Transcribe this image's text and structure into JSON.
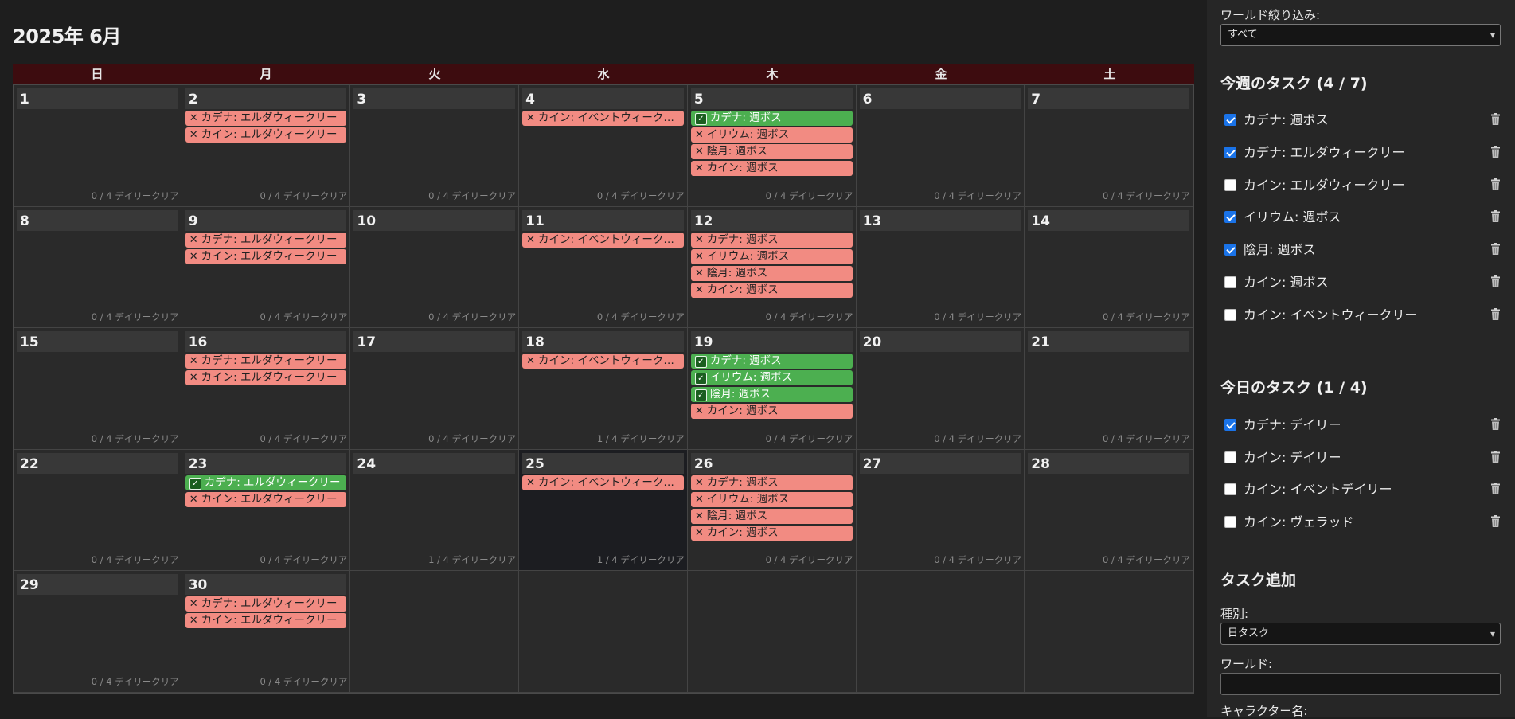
{
  "calendar": {
    "title": "2025年 6月",
    "weekdays": [
      "日",
      "月",
      "火",
      "水",
      "木",
      "金",
      "土"
    ],
    "today": 25,
    "days": [
      {
        "day": "1",
        "daily": "0 / 4 デイリークリア",
        "tasks": []
      },
      {
        "day": "2",
        "daily": "0 / 4 デイリークリア",
        "tasks": [
          {
            "label": "カデナ: エルダウィークリー",
            "done": false
          },
          {
            "label": "カイン: エルダウィークリー",
            "done": false
          }
        ]
      },
      {
        "day": "3",
        "daily": "0 / 4 デイリークリア",
        "tasks": []
      },
      {
        "day": "4",
        "daily": "0 / 4 デイリークリア",
        "tasks": [
          {
            "label": "カイン: イベントウィークリー",
            "done": false
          }
        ]
      },
      {
        "day": "5",
        "daily": "0 / 4 デイリークリア",
        "tasks": [
          {
            "label": "カデナ: 週ボス",
            "done": true
          },
          {
            "label": "イリウム: 週ボス",
            "done": false
          },
          {
            "label": "陰月: 週ボス",
            "done": false
          },
          {
            "label": "カイン: 週ボス",
            "done": false
          }
        ]
      },
      {
        "day": "6",
        "daily": "0 / 4 デイリークリア",
        "tasks": []
      },
      {
        "day": "7",
        "daily": "0 / 4 デイリークリア",
        "tasks": []
      },
      {
        "day": "8",
        "daily": "0 / 4 デイリークリア",
        "tasks": []
      },
      {
        "day": "9",
        "daily": "0 / 4 デイリークリア",
        "tasks": [
          {
            "label": "カデナ: エルダウィークリー",
            "done": false
          },
          {
            "label": "カイン: エルダウィークリー",
            "done": false
          }
        ]
      },
      {
        "day": "10",
        "daily": "0 / 4 デイリークリア",
        "tasks": []
      },
      {
        "day": "11",
        "daily": "0 / 4 デイリークリア",
        "tasks": [
          {
            "label": "カイン: イベントウィークリー",
            "done": false
          }
        ]
      },
      {
        "day": "12",
        "daily": "0 / 4 デイリークリア",
        "tasks": [
          {
            "label": "カデナ: 週ボス",
            "done": false
          },
          {
            "label": "イリウム: 週ボス",
            "done": false
          },
          {
            "label": "陰月: 週ボス",
            "done": false
          },
          {
            "label": "カイン: 週ボス",
            "done": false
          }
        ]
      },
      {
        "day": "13",
        "daily": "0 / 4 デイリークリア",
        "tasks": []
      },
      {
        "day": "14",
        "daily": "0 / 4 デイリークリア",
        "tasks": []
      },
      {
        "day": "15",
        "daily": "0 / 4 デイリークリア",
        "tasks": []
      },
      {
        "day": "16",
        "daily": "0 / 4 デイリークリア",
        "tasks": [
          {
            "label": "カデナ: エルダウィークリー",
            "done": false
          },
          {
            "label": "カイン: エルダウィークリー",
            "done": false
          }
        ]
      },
      {
        "day": "17",
        "daily": "0 / 4 デイリークリア",
        "tasks": []
      },
      {
        "day": "18",
        "daily": "1 / 4 デイリークリア",
        "tasks": [
          {
            "label": "カイン: イベントウィークリー",
            "done": false
          }
        ]
      },
      {
        "day": "19",
        "daily": "0 / 4 デイリークリア",
        "tasks": [
          {
            "label": "カデナ: 週ボス",
            "done": true
          },
          {
            "label": "イリウム: 週ボス",
            "done": true
          },
          {
            "label": "陰月: 週ボス",
            "done": true
          },
          {
            "label": "カイン: 週ボス",
            "done": false
          }
        ]
      },
      {
        "day": "20",
        "daily": "0 / 4 デイリークリア",
        "tasks": []
      },
      {
        "day": "21",
        "daily": "0 / 4 デイリークリア",
        "tasks": []
      },
      {
        "day": "22",
        "daily": "0 / 4 デイリークリア",
        "tasks": []
      },
      {
        "day": "23",
        "daily": "0 / 4 デイリークリア",
        "tasks": [
          {
            "label": "カデナ: エルダウィークリー",
            "done": true
          },
          {
            "label": "カイン: エルダウィークリー",
            "done": false
          }
        ]
      },
      {
        "day": "24",
        "daily": "1 / 4 デイリークリア",
        "tasks": []
      },
      {
        "day": "25",
        "daily": "1 / 4 デイリークリア",
        "tasks": [
          {
            "label": "カイン: イベントウィークリー",
            "done": false
          }
        ]
      },
      {
        "day": "26",
        "daily": "0 / 4 デイリークリア",
        "tasks": [
          {
            "label": "カデナ: 週ボス",
            "done": false
          },
          {
            "label": "イリウム: 週ボス",
            "done": false
          },
          {
            "label": "陰月: 週ボス",
            "done": false
          },
          {
            "label": "カイン: 週ボス",
            "done": false
          }
        ]
      },
      {
        "day": "27",
        "daily": "0 / 4 デイリークリア",
        "tasks": []
      },
      {
        "day": "28",
        "daily": "0 / 4 デイリークリア",
        "tasks": []
      },
      {
        "day": "29",
        "daily": "0 / 4 デイリークリア",
        "tasks": []
      },
      {
        "day": "30",
        "daily": "0 / 4 デイリークリア",
        "tasks": [
          {
            "label": "カデナ: エルダウィークリー",
            "done": false
          },
          {
            "label": "カイン: エルダウィークリー",
            "done": false
          }
        ]
      }
    ],
    "trailing_empty_cells": 5,
    "done_mark": "✓",
    "pending_mark": "✕"
  },
  "sidebar": {
    "world_filter_label": "ワールド絞り込み:",
    "world_filter_value": "すべて",
    "weekly_title": "今週のタスク (4 / 7)",
    "weekly_tasks": [
      {
        "label": "カデナ: 週ボス",
        "checked": true
      },
      {
        "label": "カデナ: エルダウィークリー",
        "checked": true
      },
      {
        "label": "カイン: エルダウィークリー",
        "checked": false
      },
      {
        "label": "イリウム: 週ボス",
        "checked": true
      },
      {
        "label": "陰月: 週ボス",
        "checked": true
      },
      {
        "label": "カイン: 週ボス",
        "checked": false
      },
      {
        "label": "カイン: イベントウィークリー",
        "checked": false
      }
    ],
    "daily_title": "今日のタスク (1 / 4)",
    "daily_tasks": [
      {
        "label": "カデナ: デイリー",
        "checked": true
      },
      {
        "label": "カイン: デイリー",
        "checked": false
      },
      {
        "label": "カイン: イベントデイリー",
        "checked": false
      },
      {
        "label": "カイン: ヴェラッド",
        "checked": false
      }
    ],
    "add_title": "タスク追加",
    "type_label": "種別:",
    "type_value": "日タスク",
    "world_label": "ワールド:",
    "world_value": "",
    "character_label": "キャラクター名:"
  },
  "colors": {
    "done_task": "#4caf50",
    "pending_task": "#f28b82",
    "header_bar": "#3d0c0f",
    "checkbox_on": "#1a73e8"
  }
}
